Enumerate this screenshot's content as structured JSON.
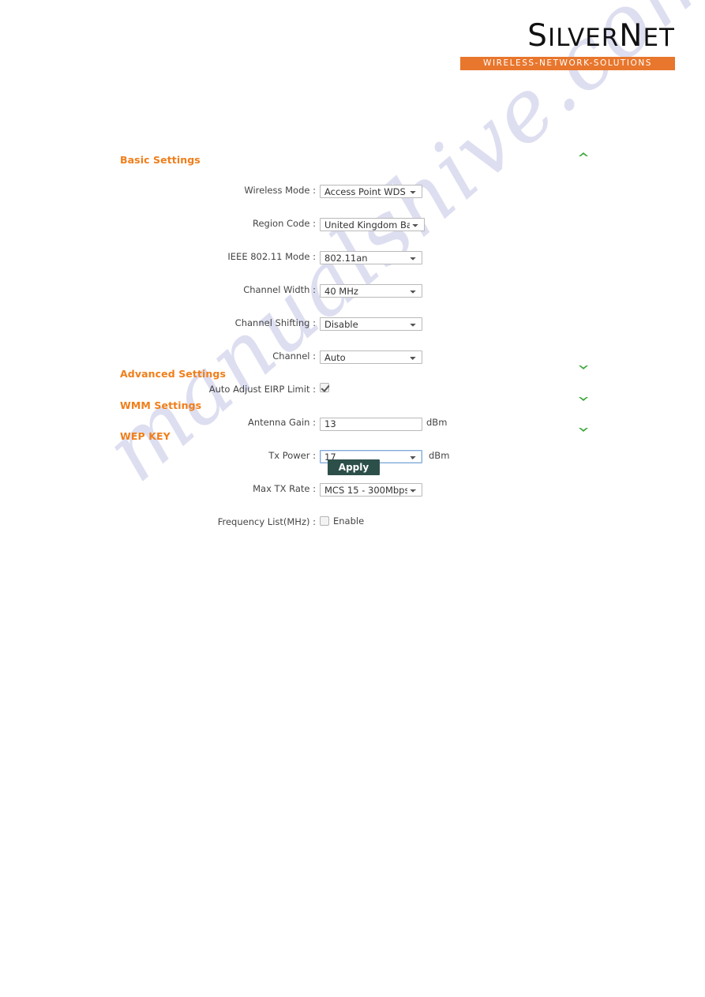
{
  "logo": {
    "brand_part1": "S",
    "brand_part2": "ILVER",
    "brand_part3": "N",
    "brand_part4": "ET",
    "tagline": "WIRELESS-NETWORK-SOLUTIONS",
    "bar_color": "#e8762c"
  },
  "watermark": {
    "text": "manualshive.com",
    "color": "#c9cbe8"
  },
  "sections": {
    "basic": {
      "title": "Basic Settings",
      "chevron": "chevron-up-icon",
      "expanded": true
    },
    "advanced": {
      "title": "Advanced Settings",
      "chevron": "chevron-down-icon",
      "expanded": false
    },
    "wmm": {
      "title": "WMM Settings",
      "chevron": "chevron-down-icon",
      "expanded": false
    },
    "wep": {
      "title": "WEP KEY",
      "chevron": "chevron-down-icon",
      "expanded": false
    }
  },
  "form": {
    "wireless_mode": {
      "label": "Wireless Mode :",
      "value": "Access Point WDS",
      "type": "select"
    },
    "region_code": {
      "label": "Region Code :",
      "value": "United Kingdom Band B",
      "type": "select"
    },
    "ieee_mode": {
      "label": "IEEE 802.11 Mode :",
      "value": "802.11an",
      "type": "select"
    },
    "channel_width": {
      "label": "Channel Width :",
      "value": "40 MHz",
      "type": "select"
    },
    "channel_shifting": {
      "label": "Channel Shifting :",
      "value": "Disable",
      "type": "select"
    },
    "channel": {
      "label": "Channel :",
      "value": "Auto",
      "type": "select"
    },
    "auto_adjust_eirp": {
      "label": "Auto Adjust EIRP Limit :",
      "checked": true,
      "type": "checkbox"
    },
    "antenna_gain": {
      "label": "Antenna Gain :",
      "value": "13",
      "unit": "dBm",
      "type": "text"
    },
    "tx_power": {
      "label": "Tx Power :",
      "value": "17",
      "unit": "dBm",
      "type": "select",
      "focused": true
    },
    "max_tx_rate": {
      "label": "Max TX Rate :",
      "value": "MCS 15 - 300Mbps",
      "type": "select"
    },
    "frequency_list": {
      "label": "Frequency List(MHz) :",
      "checkbox_label": "Enable",
      "checked": false,
      "type": "checkbox"
    }
  },
  "buttons": {
    "apply": "Apply"
  },
  "colors": {
    "heading_orange": "#f07e1a",
    "chevron_green": "#3fa83f",
    "apply_bg": "#2d4f4a",
    "focus_border": "#7fa9d8"
  }
}
